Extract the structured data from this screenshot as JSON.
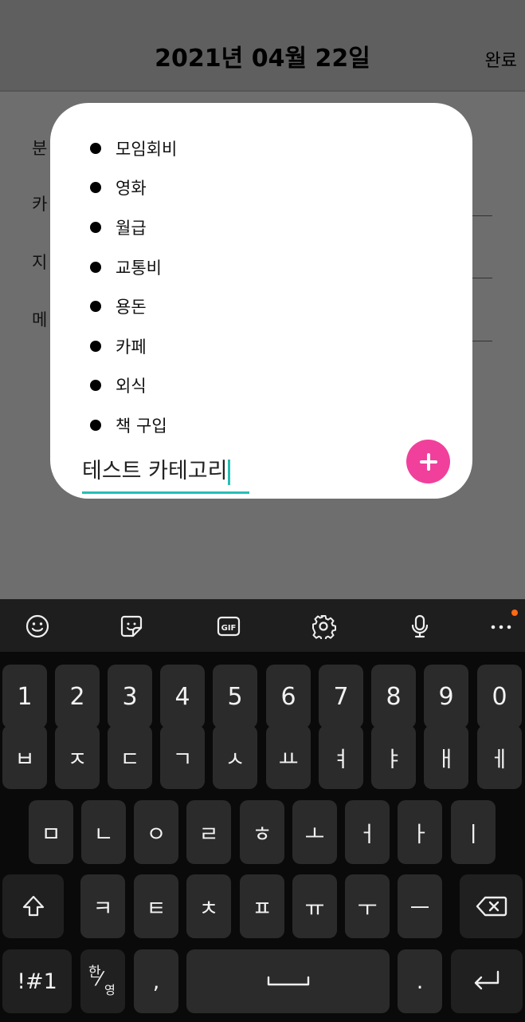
{
  "header": {
    "title": "2021년 04월 22일",
    "done_label": "완료"
  },
  "background_form": {
    "labels": [
      "분",
      "카",
      "지",
      "메"
    ]
  },
  "dialog": {
    "categories": [
      "모임회비",
      "영화",
      "월급",
      "교통비",
      "용돈",
      "카페",
      "외식",
      "책 구입"
    ],
    "input_value": "테스트 카테고리",
    "add_icon": "plus-icon"
  },
  "keyboard": {
    "toolbar_icons": [
      "emoji-icon",
      "sticker-icon",
      "gif-icon",
      "settings-icon",
      "mic-icon",
      "more-icon"
    ],
    "gif_label": "GIF",
    "row_numbers": [
      "1",
      "2",
      "3",
      "4",
      "5",
      "6",
      "7",
      "8",
      "9",
      "0"
    ],
    "row1": [
      "ㅂ",
      "ㅈ",
      "ㄷ",
      "ㄱ",
      "ㅅ",
      "ㅛ",
      "ㅕ",
      "ㅑ",
      "ㅐ",
      "ㅔ"
    ],
    "row2": [
      "ㅁ",
      "ㄴ",
      "ㅇ",
      "ㄹ",
      "ㅎ",
      "ㅗ",
      "ㅓ",
      "ㅏ",
      "ㅣ"
    ],
    "row3": [
      "ㅋ",
      "ㅌ",
      "ㅊ",
      "ㅍ",
      "ㅠ",
      "ㅜ",
      "ㅡ"
    ],
    "symbols_label": "!#1",
    "lang_han": "한",
    "lang_slash": "⁄",
    "lang_eng": "영",
    "comma": ",",
    "period": ".",
    "accent_color": "#26bfb5",
    "add_button_color": "#f0409c"
  }
}
